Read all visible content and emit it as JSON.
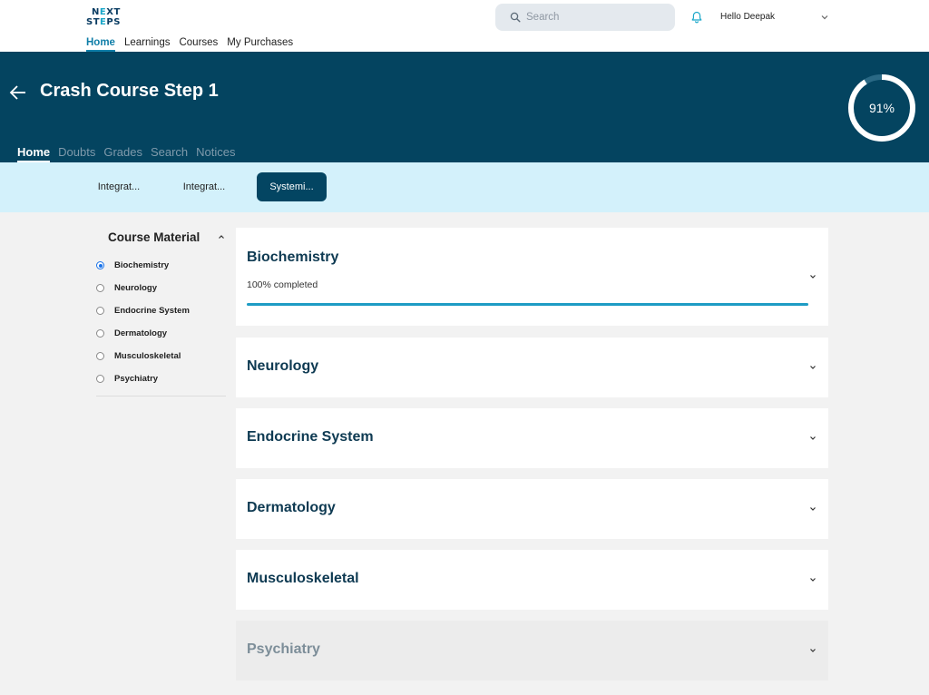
{
  "brand": {
    "line1_a": "N",
    "line1_b": "X",
    "line1_c": "T",
    "line1_e": "E",
    "line2_a": "ST",
    "line2_b": "E",
    "line2_c": "PS"
  },
  "topnav": {
    "items": [
      "Home",
      "Learnings",
      "Courses",
      "My Purchases"
    ],
    "active": "Home"
  },
  "search": {
    "placeholder": "Search"
  },
  "user": {
    "greeting": "Hello Deepak"
  },
  "course": {
    "title": "Crash Course Step 1",
    "progress": 0.91,
    "progress_label": "91%"
  },
  "subtabs": {
    "items": [
      "Home",
      "Doubts",
      "Grades",
      "Search",
      "Notices"
    ],
    "active": "Home"
  },
  "chips": {
    "items": [
      "Integrat...",
      "Integrat...",
      "Systemi..."
    ],
    "active_index": 2
  },
  "sidebar": {
    "title": "Course Material",
    "items": [
      "Biochemistry",
      "Neurology",
      "Endocrine System",
      "Dermatology",
      "Musculoskeletal",
      "Psychiatry"
    ],
    "selected_index": 0
  },
  "modules": [
    {
      "title": "Biochemistry",
      "status": "100% completed",
      "progress": 1.0
    },
    {
      "title": "Neurology"
    },
    {
      "title": "Endocrine System"
    },
    {
      "title": "Dermatology"
    },
    {
      "title": "Musculoskeletal"
    },
    {
      "title": "Psychiatry"
    }
  ],
  "colors": {
    "header_bg": "#044460",
    "chip_bar_bg": "#d3f1fb",
    "active_chip_bg": "#034562",
    "accent": "#0f7ea8",
    "progress_fill": "#1e9cc4"
  },
  "icons": [
    "search-icon",
    "bell-icon",
    "chevron-down-icon",
    "back-arrow-icon",
    "chevron-up-icon"
  ]
}
